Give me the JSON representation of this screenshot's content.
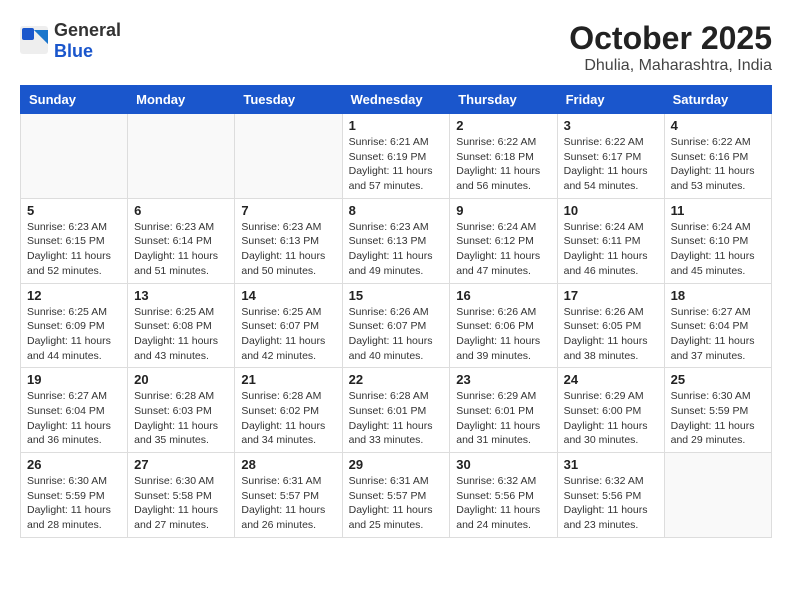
{
  "header": {
    "logo_general": "General",
    "logo_blue": "Blue",
    "month": "October 2025",
    "location": "Dhulia, Maharashtra, India"
  },
  "days_of_week": [
    "Sunday",
    "Monday",
    "Tuesday",
    "Wednesday",
    "Thursday",
    "Friday",
    "Saturday"
  ],
  "weeks": [
    [
      {
        "day": "",
        "info": ""
      },
      {
        "day": "",
        "info": ""
      },
      {
        "day": "",
        "info": ""
      },
      {
        "day": "1",
        "info": "Sunrise: 6:21 AM\nSunset: 6:19 PM\nDaylight: 11 hours\nand 57 minutes."
      },
      {
        "day": "2",
        "info": "Sunrise: 6:22 AM\nSunset: 6:18 PM\nDaylight: 11 hours\nand 56 minutes."
      },
      {
        "day": "3",
        "info": "Sunrise: 6:22 AM\nSunset: 6:17 PM\nDaylight: 11 hours\nand 54 minutes."
      },
      {
        "day": "4",
        "info": "Sunrise: 6:22 AM\nSunset: 6:16 PM\nDaylight: 11 hours\nand 53 minutes."
      }
    ],
    [
      {
        "day": "5",
        "info": "Sunrise: 6:23 AM\nSunset: 6:15 PM\nDaylight: 11 hours\nand 52 minutes."
      },
      {
        "day": "6",
        "info": "Sunrise: 6:23 AM\nSunset: 6:14 PM\nDaylight: 11 hours\nand 51 minutes."
      },
      {
        "day": "7",
        "info": "Sunrise: 6:23 AM\nSunset: 6:13 PM\nDaylight: 11 hours\nand 50 minutes."
      },
      {
        "day": "8",
        "info": "Sunrise: 6:23 AM\nSunset: 6:13 PM\nDaylight: 11 hours\nand 49 minutes."
      },
      {
        "day": "9",
        "info": "Sunrise: 6:24 AM\nSunset: 6:12 PM\nDaylight: 11 hours\nand 47 minutes."
      },
      {
        "day": "10",
        "info": "Sunrise: 6:24 AM\nSunset: 6:11 PM\nDaylight: 11 hours\nand 46 minutes."
      },
      {
        "day": "11",
        "info": "Sunrise: 6:24 AM\nSunset: 6:10 PM\nDaylight: 11 hours\nand 45 minutes."
      }
    ],
    [
      {
        "day": "12",
        "info": "Sunrise: 6:25 AM\nSunset: 6:09 PM\nDaylight: 11 hours\nand 44 minutes."
      },
      {
        "day": "13",
        "info": "Sunrise: 6:25 AM\nSunset: 6:08 PM\nDaylight: 11 hours\nand 43 minutes."
      },
      {
        "day": "14",
        "info": "Sunrise: 6:25 AM\nSunset: 6:07 PM\nDaylight: 11 hours\nand 42 minutes."
      },
      {
        "day": "15",
        "info": "Sunrise: 6:26 AM\nSunset: 6:07 PM\nDaylight: 11 hours\nand 40 minutes."
      },
      {
        "day": "16",
        "info": "Sunrise: 6:26 AM\nSunset: 6:06 PM\nDaylight: 11 hours\nand 39 minutes."
      },
      {
        "day": "17",
        "info": "Sunrise: 6:26 AM\nSunset: 6:05 PM\nDaylight: 11 hours\nand 38 minutes."
      },
      {
        "day": "18",
        "info": "Sunrise: 6:27 AM\nSunset: 6:04 PM\nDaylight: 11 hours\nand 37 minutes."
      }
    ],
    [
      {
        "day": "19",
        "info": "Sunrise: 6:27 AM\nSunset: 6:04 PM\nDaylight: 11 hours\nand 36 minutes."
      },
      {
        "day": "20",
        "info": "Sunrise: 6:28 AM\nSunset: 6:03 PM\nDaylight: 11 hours\nand 35 minutes."
      },
      {
        "day": "21",
        "info": "Sunrise: 6:28 AM\nSunset: 6:02 PM\nDaylight: 11 hours\nand 34 minutes."
      },
      {
        "day": "22",
        "info": "Sunrise: 6:28 AM\nSunset: 6:01 PM\nDaylight: 11 hours\nand 33 minutes."
      },
      {
        "day": "23",
        "info": "Sunrise: 6:29 AM\nSunset: 6:01 PM\nDaylight: 11 hours\nand 31 minutes."
      },
      {
        "day": "24",
        "info": "Sunrise: 6:29 AM\nSunset: 6:00 PM\nDaylight: 11 hours\nand 30 minutes."
      },
      {
        "day": "25",
        "info": "Sunrise: 6:30 AM\nSunset: 5:59 PM\nDaylight: 11 hours\nand 29 minutes."
      }
    ],
    [
      {
        "day": "26",
        "info": "Sunrise: 6:30 AM\nSunset: 5:59 PM\nDaylight: 11 hours\nand 28 minutes."
      },
      {
        "day": "27",
        "info": "Sunrise: 6:30 AM\nSunset: 5:58 PM\nDaylight: 11 hours\nand 27 minutes."
      },
      {
        "day": "28",
        "info": "Sunrise: 6:31 AM\nSunset: 5:57 PM\nDaylight: 11 hours\nand 26 minutes."
      },
      {
        "day": "29",
        "info": "Sunrise: 6:31 AM\nSunset: 5:57 PM\nDaylight: 11 hours\nand 25 minutes."
      },
      {
        "day": "30",
        "info": "Sunrise: 6:32 AM\nSunset: 5:56 PM\nDaylight: 11 hours\nand 24 minutes."
      },
      {
        "day": "31",
        "info": "Sunrise: 6:32 AM\nSunset: 5:56 PM\nDaylight: 11 hours\nand 23 minutes."
      },
      {
        "day": "",
        "info": ""
      }
    ]
  ]
}
